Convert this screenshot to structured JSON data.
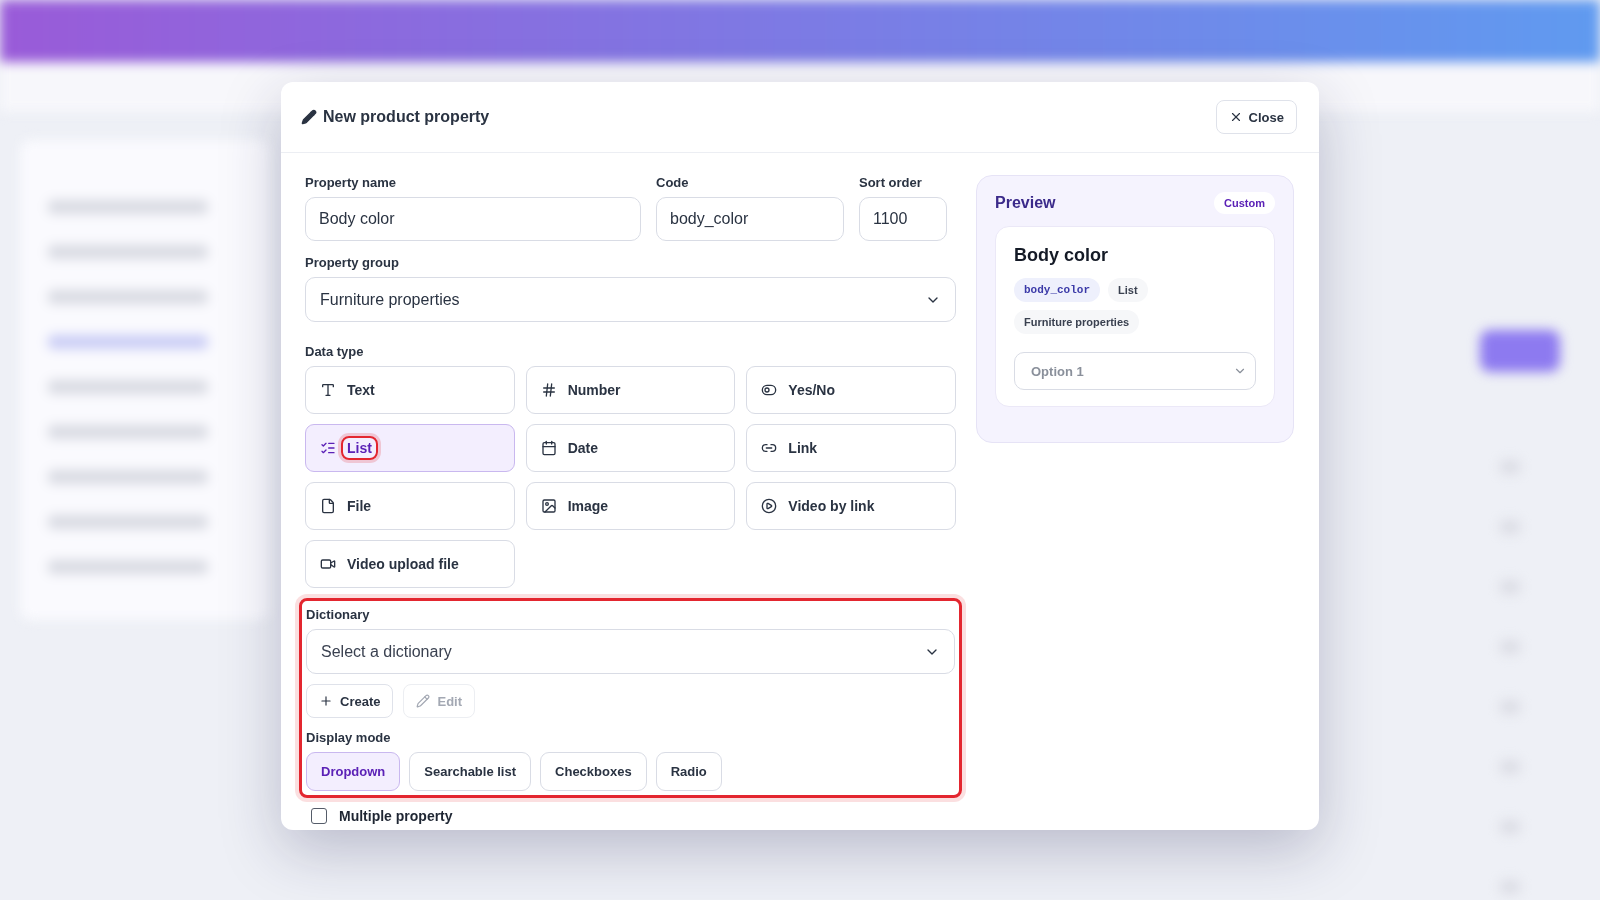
{
  "dialog": {
    "title": "New product property",
    "close_label": "Close"
  },
  "fields": [
    {
      "label": "Property name",
      "value": "Body color"
    },
    {
      "label": "Code",
      "value": "body_color"
    },
    {
      "label": "Sort order",
      "value": "1100"
    }
  ],
  "property_group": {
    "label": "Property group",
    "value": "Furniture properties"
  },
  "data_type": {
    "label": "Data type",
    "options": [
      {
        "kind": "text",
        "label": "Text",
        "selected": false,
        "highlighted": false
      },
      {
        "kind": "number",
        "label": "Number",
        "selected": false,
        "highlighted": false
      },
      {
        "kind": "toggle",
        "label": "Yes/No",
        "selected": false,
        "highlighted": false
      },
      {
        "kind": "list",
        "label": "List",
        "selected": true,
        "highlighted": true
      },
      {
        "kind": "date",
        "label": "Date",
        "selected": false,
        "highlighted": false
      },
      {
        "kind": "link",
        "label": "Link",
        "selected": false,
        "highlighted": false
      },
      {
        "kind": "file",
        "label": "File",
        "selected": false,
        "highlighted": false
      },
      {
        "kind": "image",
        "label": "Image",
        "selected": false,
        "highlighted": false
      },
      {
        "kind": "video_link",
        "label": "Video by link",
        "selected": false,
        "highlighted": false
      },
      {
        "kind": "video_file",
        "label": "Video upload file",
        "selected": false,
        "highlighted": false
      }
    ]
  },
  "dictionary": {
    "highlighted": true,
    "label": "Dictionary",
    "placeholder": "Select a dictionary",
    "actions": [
      {
        "kind": "create",
        "label": "Create",
        "disabled": false
      },
      {
        "kind": "edit",
        "label": "Edit",
        "disabled": true
      }
    ],
    "display_mode_label": "Display mode",
    "display_modes": [
      {
        "label": "Dropdown",
        "selected": true
      },
      {
        "label": "Searchable list",
        "selected": false
      },
      {
        "label": "Checkboxes",
        "selected": false
      },
      {
        "label": "Radio",
        "selected": false
      }
    ]
  },
  "multiple": {
    "label": "Multiple property",
    "checked": false
  },
  "preview": {
    "title": "Preview",
    "badge": "Custom",
    "name": "Body color",
    "tags": [
      {
        "kind": "code",
        "label": "body_color"
      },
      {
        "kind": "plain",
        "label": "List"
      },
      {
        "kind": "plain",
        "label": "Furniture properties"
      }
    ],
    "select_value": "Option 1"
  }
}
